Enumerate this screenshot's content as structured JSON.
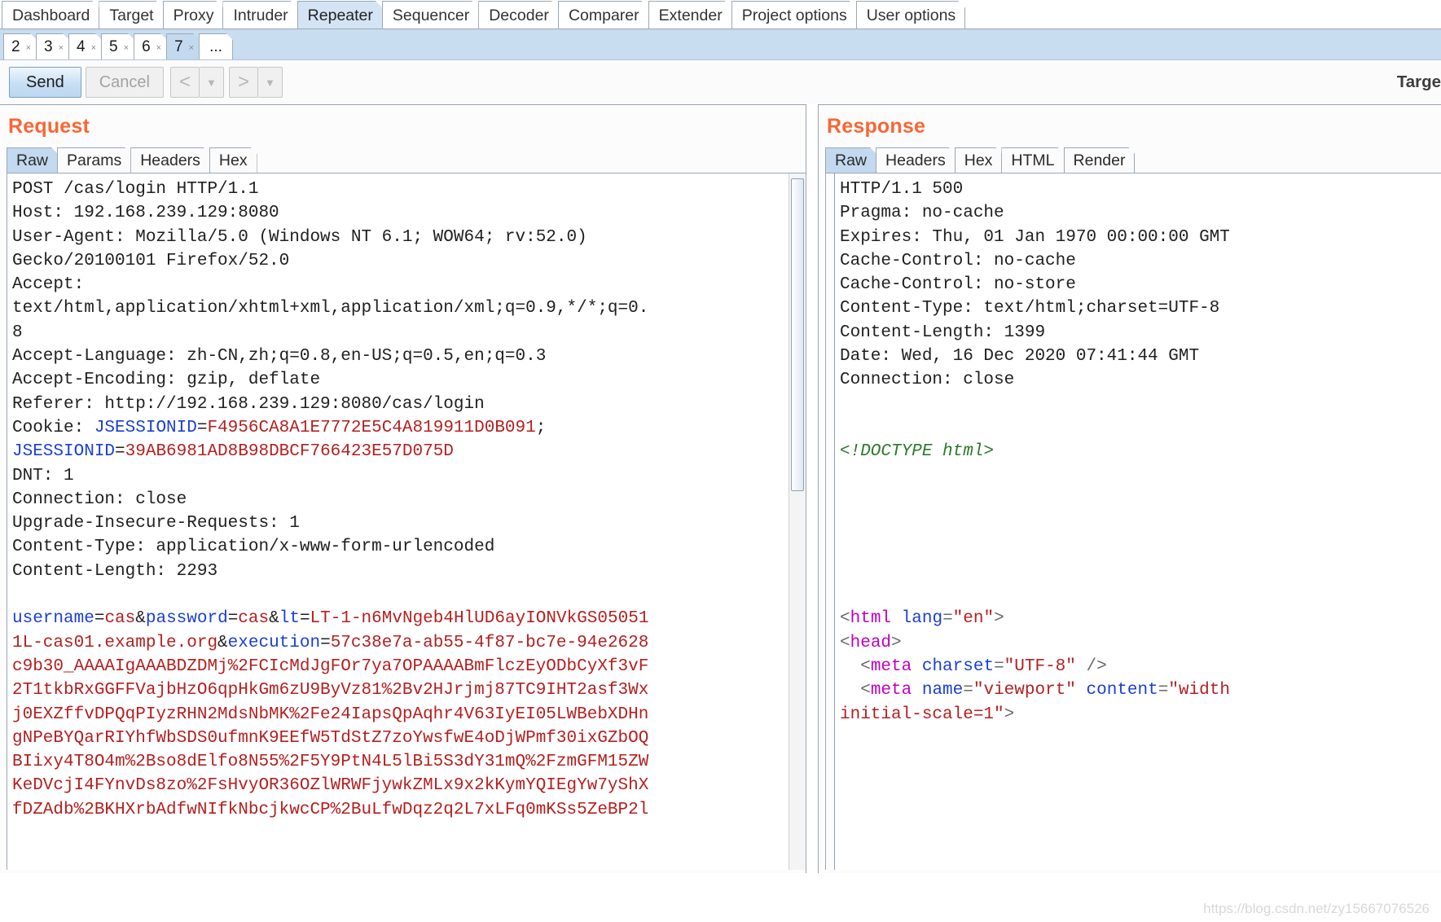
{
  "app": {
    "name": "Burp Suite Repeater",
    "target_label": "Targe"
  },
  "main_tabs": [
    {
      "label": "Dashboard",
      "selected": false
    },
    {
      "label": "Target",
      "selected": false
    },
    {
      "label": "Proxy",
      "selected": false
    },
    {
      "label": "Intruder",
      "selected": false
    },
    {
      "label": "Repeater",
      "selected": true
    },
    {
      "label": "Sequencer",
      "selected": false
    },
    {
      "label": "Decoder",
      "selected": false
    },
    {
      "label": "Comparer",
      "selected": false
    },
    {
      "label": "Extender",
      "selected": false
    },
    {
      "label": "Project options",
      "selected": false
    },
    {
      "label": "User options",
      "selected": false
    }
  ],
  "repeater_tabs": [
    {
      "label": "2",
      "close": "×",
      "selected": false
    },
    {
      "label": "3",
      "close": "×",
      "selected": false
    },
    {
      "label": "4",
      "close": "×",
      "selected": false
    },
    {
      "label": "5",
      "close": "×",
      "selected": false
    },
    {
      "label": "6",
      "close": "×",
      "selected": false
    },
    {
      "label": "7",
      "close": "×",
      "selected": true
    },
    {
      "label": "...",
      "close": "",
      "selected": false
    }
  ],
  "toolbar": {
    "send_label": "Send",
    "cancel_label": "Cancel",
    "back_icon": "<",
    "back_dropdown_icon": "▼",
    "forward_icon": ">",
    "forward_dropdown_icon": "▼"
  },
  "request": {
    "title": "Request",
    "tabs": [
      {
        "label": "Raw",
        "selected": true
      },
      {
        "label": "Params",
        "selected": false
      },
      {
        "label": "Headers",
        "selected": false
      },
      {
        "label": "Hex",
        "selected": false
      }
    ],
    "lines": [
      [
        {
          "t": "POST /cas/login HTTP/1.1",
          "c": "plain"
        }
      ],
      [
        {
          "t": "Host: 192.168.239.129:8080",
          "c": "plain"
        }
      ],
      [
        {
          "t": "User-Agent: Mozilla/5.0 (Windows NT 6.1; WOW64; rv:52.0)",
          "c": "plain"
        }
      ],
      [
        {
          "t": "Gecko/20100101 Firefox/52.0",
          "c": "plain"
        }
      ],
      [
        {
          "t": "Accept:",
          "c": "plain"
        }
      ],
      [
        {
          "t": "text/html,application/xhtml+xml,application/xml;q=0.9,*/*;q=0.",
          "c": "plain"
        }
      ],
      [
        {
          "t": "8",
          "c": "plain"
        }
      ],
      [
        {
          "t": "Accept-Language: zh-CN,zh;q=0.8,en-US;q=0.5,en;q=0.3",
          "c": "plain"
        }
      ],
      [
        {
          "t": "Accept-Encoding: gzip, deflate",
          "c": "plain"
        }
      ],
      [
        {
          "t": "Referer: http://192.168.239.129:8080/cas/login",
          "c": "plain"
        }
      ],
      [
        {
          "t": "Cookie: ",
          "c": "plain"
        },
        {
          "t": "JSESSIONID",
          "c": "key"
        },
        {
          "t": "=",
          "c": "plain"
        },
        {
          "t": "F4956CA8A1E7772E5C4A819911D0B091",
          "c": "val"
        },
        {
          "t": ";",
          "c": "plain"
        }
      ],
      [
        {
          "t": "JSESSIONID",
          "c": "key"
        },
        {
          "t": "=",
          "c": "plain"
        },
        {
          "t": "39AB6981AD8B98DBCF766423E57D075D",
          "c": "val"
        }
      ],
      [
        {
          "t": "DNT: 1",
          "c": "plain"
        }
      ],
      [
        {
          "t": "Connection: close",
          "c": "plain"
        }
      ],
      [
        {
          "t": "Upgrade-Insecure-Requests: 1",
          "c": "plain"
        }
      ],
      [
        {
          "t": "Content-Type: application/x-www-form-urlencoded",
          "c": "plain"
        }
      ],
      [
        {
          "t": "Content-Length: 2293",
          "c": "plain"
        }
      ],
      [
        {
          "t": "",
          "c": "plain"
        }
      ],
      [
        {
          "t": "username",
          "c": "key"
        },
        {
          "t": "=",
          "c": "plain"
        },
        {
          "t": "cas",
          "c": "val"
        },
        {
          "t": "&",
          "c": "plain"
        },
        {
          "t": "password",
          "c": "key"
        },
        {
          "t": "=",
          "c": "plain"
        },
        {
          "t": "cas",
          "c": "val"
        },
        {
          "t": "&",
          "c": "plain"
        },
        {
          "t": "lt",
          "c": "key"
        },
        {
          "t": "=",
          "c": "plain"
        },
        {
          "t": "LT-1-n6MvNgeb4HlUD6ayIONVkGS05051",
          "c": "val"
        }
      ],
      [
        {
          "t": "1L-cas01.example.org",
          "c": "val"
        },
        {
          "t": "&",
          "c": "plain"
        },
        {
          "t": "execution",
          "c": "key"
        },
        {
          "t": "=",
          "c": "plain"
        },
        {
          "t": "57c38e7a-ab55-4f87-bc7e-94e2628",
          "c": "val"
        }
      ],
      [
        {
          "t": "c9b30_AAAAIgAAABDZDMj%2FCIcMdJgFOr7ya7OPAAAABmFlczEyODbCyXf3vF",
          "c": "val"
        }
      ],
      [
        {
          "t": "2T1tkbRxGGFFVajbHzO6qpHkGm6zU9ByVz81%2Bv2HJrjmj87TC9IHT2asf3Wx",
          "c": "val"
        }
      ],
      [
        {
          "t": "j0EXZffvDPQqPIyzRHN2MdsNbMK%2Fe24IapsQpAqhr4V63IyEI05LWBebXDHn",
          "c": "val"
        }
      ],
      [
        {
          "t": "gNPeBYQarRIYhfWbSDS0ufmnK9EEfW5TdStZ7zoYwsfwE4oDjWPmf30ixGZbOQ",
          "c": "val"
        }
      ],
      [
        {
          "t": "BIixy4T8O4m%2Bso8dElfo8N55%2F5Y9PtN4L5lBi5S3dY31mQ%2FzmGFM15ZW",
          "c": "val"
        }
      ],
      [
        {
          "t": "KeDVcjI4FYnvDs8zo%2FsHvyOR36OZlWRWFjywkZMLx9x2kKymYQIEgYw7yShX",
          "c": "val"
        }
      ],
      [
        {
          "t": "fDZAdb%2BKHXrbAdfwNIfkNbcjkwcCP%2BuLfwDqz2q2L7xLFq0mKSs5ZeBP2l",
          "c": "val"
        }
      ]
    ],
    "scrollbar": {
      "orientation": "vertical",
      "thumb_position": "top"
    }
  },
  "response": {
    "title": "Response",
    "tabs": [
      {
        "label": "Raw",
        "selected": true
      },
      {
        "label": "Headers",
        "selected": false
      },
      {
        "label": "Hex",
        "selected": false
      },
      {
        "label": "HTML",
        "selected": false
      },
      {
        "label": "Render",
        "selected": false
      }
    ],
    "lines": [
      [
        {
          "t": "HTTP/1.1 500",
          "c": "plain"
        }
      ],
      [
        {
          "t": "Pragma: no-cache",
          "c": "plain"
        }
      ],
      [
        {
          "t": "Expires: Thu, 01 Jan 1970 00:00:00 GMT",
          "c": "plain"
        }
      ],
      [
        {
          "t": "Cache-Control: no-cache",
          "c": "plain"
        }
      ],
      [
        {
          "t": "Cache-Control: no-store",
          "c": "plain"
        }
      ],
      [
        {
          "t": "Content-Type: text/html;charset=UTF-8",
          "c": "plain"
        }
      ],
      [
        {
          "t": "Content-Length: 1399",
          "c": "plain"
        }
      ],
      [
        {
          "t": "Date: Wed, 16 Dec 2020 07:41:44 GMT",
          "c": "plain"
        }
      ],
      [
        {
          "t": "Connection: close",
          "c": "plain"
        }
      ],
      [
        {
          "t": "",
          "c": "plain"
        }
      ],
      [
        {
          "t": "",
          "c": "plain"
        }
      ],
      [
        {
          "t": "<!DOCTYPE html>",
          "c": "comment"
        }
      ],
      [
        {
          "t": "",
          "c": "plain"
        }
      ],
      [
        {
          "t": "",
          "c": "plain"
        }
      ],
      [
        {
          "t": "",
          "c": "plain"
        }
      ],
      [
        {
          "t": "",
          "c": "plain"
        }
      ],
      [
        {
          "t": "",
          "c": "plain"
        }
      ],
      [
        {
          "t": "",
          "c": "plain"
        }
      ],
      [
        {
          "t": "<",
          "c": "punct"
        },
        {
          "t": "html",
          "c": "tag"
        },
        {
          "t": " ",
          "c": "plain"
        },
        {
          "t": "lang",
          "c": "key"
        },
        {
          "t": "=",
          "c": "punct"
        },
        {
          "t": "\"en\"",
          "c": "val"
        },
        {
          "t": ">",
          "c": "punct"
        }
      ],
      [
        {
          "t": "<",
          "c": "punct"
        },
        {
          "t": "head",
          "c": "tag"
        },
        {
          "t": ">",
          "c": "punct"
        }
      ],
      [
        {
          "t": "  <",
          "c": "punct"
        },
        {
          "t": "meta",
          "c": "tag"
        },
        {
          "t": " ",
          "c": "plain"
        },
        {
          "t": "charset",
          "c": "key"
        },
        {
          "t": "=",
          "c": "punct"
        },
        {
          "t": "\"UTF-8\"",
          "c": "val"
        },
        {
          "t": " />",
          "c": "punct"
        }
      ],
      [
        {
          "t": "  <",
          "c": "punct"
        },
        {
          "t": "meta",
          "c": "tag"
        },
        {
          "t": " ",
          "c": "plain"
        },
        {
          "t": "name",
          "c": "key"
        },
        {
          "t": "=",
          "c": "punct"
        },
        {
          "t": "\"viewport\"",
          "c": "val"
        },
        {
          "t": " ",
          "c": "plain"
        },
        {
          "t": "content",
          "c": "key"
        },
        {
          "t": "=",
          "c": "punct"
        },
        {
          "t": "\"width",
          "c": "val"
        }
      ],
      [
        {
          "t": "initial-scale=1\"",
          "c": "val"
        },
        {
          "t": ">",
          "c": "punct"
        }
      ]
    ]
  },
  "watermark": {
    "text": "https://blog.csdn.net/zy15667076526"
  }
}
